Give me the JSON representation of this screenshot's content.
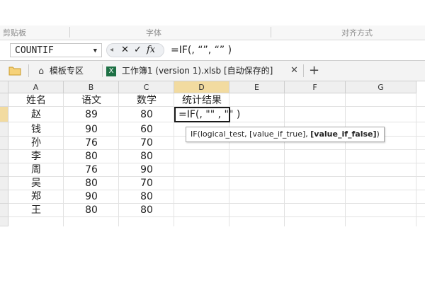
{
  "ribbon": {
    "groups": [
      "剪贴板",
      "字体",
      "对齐方式"
    ]
  },
  "formula_bar": {
    "name_box": "COUNTIF",
    "cancel_icon": "✕",
    "confirm_icon": "✓",
    "fx_icon": "fx",
    "formula": "=IF(, “”, “” )"
  },
  "tabs": {
    "items": [
      {
        "label": "模板专区",
        "icon": "home-icon"
      },
      {
        "label": "工作簿1 (version 1).xlsb [自动保存的]",
        "icon": "excel-icon"
      }
    ],
    "close": "✕",
    "add": "+"
  },
  "sheet": {
    "columns": [
      "A",
      "B",
      "C",
      "D",
      "E",
      "F",
      "G"
    ],
    "headers": [
      "姓名",
      "语文",
      "数学",
      "统计结果"
    ],
    "rows": [
      {
        "name": "赵",
        "chinese": "89",
        "math": "80"
      },
      {
        "name": "钱",
        "chinese": "90",
        "math": "60"
      },
      {
        "name": "孙",
        "chinese": "76",
        "math": "70"
      },
      {
        "name": "李",
        "chinese": "80",
        "math": "80"
      },
      {
        "name": "周",
        "chinese": "76",
        "math": "90"
      },
      {
        "name": "吴",
        "chinese": "80",
        "math": "70"
      },
      {
        "name": "郑",
        "chinese": "90",
        "math": "80"
      },
      {
        "name": "王",
        "chinese": "80",
        "math": "80"
      }
    ],
    "active_cell_text": "=IF(, \"\" , \"\" )",
    "tooltip": {
      "prefix": "IF(logical_test, [value_if_true], ",
      "bold": "[value_if_false]",
      "suffix": ")"
    }
  },
  "colors": {
    "selected_header": "#f2dba0",
    "excel_green": "#1e7145"
  }
}
